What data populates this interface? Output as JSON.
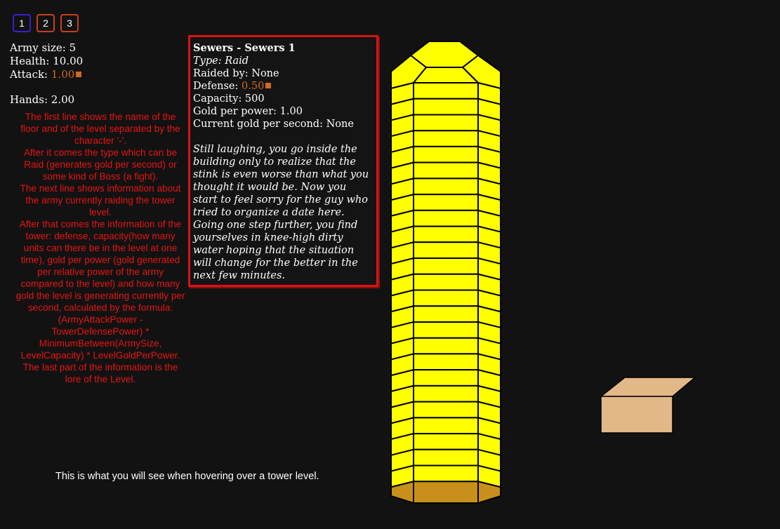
{
  "tabs": [
    {
      "label": "1",
      "color": "#3a1fd0"
    },
    {
      "label": "2",
      "color": "#c8401c"
    },
    {
      "label": "3",
      "color": "#c8401c"
    }
  ],
  "army": {
    "size_label": "Army size: 5",
    "health_label": "Health: 10.00",
    "attack_label": "Attack: ",
    "attack_value": "1.00",
    "hands_label": "Hands: 2.00"
  },
  "help_text": [
    "The first line shows the name of the floor and of the level separated by the character '-'.",
    "After it comes the type which can be Raid (generates gold per second) or some kind of Boss (a fight).",
    "The next line shows information about the army currently raiding the tower level.",
    "After that comes the information of the tower: defense, capacity(how many units can there be in the level at one time), gold per power (gold generated per relative power of the army compared to the level) and how many gold the level is generating currently per second, calculated by the formula: (ArmyAttackPower - TowerDefensePower) * MinimumBetween(ArmySize, LevelCapacity) * LevelGoldPerPower.",
    "The last part of the information is the lore of the Level."
  ],
  "tooltip": {
    "title": "Sewers - Sewers 1",
    "type": "Type: Raid",
    "raided_by": "Raided by: None",
    "defense_label": "Defense: ",
    "defense_value": "0.50",
    "capacity": "Capacity: 500",
    "gold_per_power": "Gold per power: 1.00",
    "current_gold": "Current gold per second: None",
    "lore": [
      "Still laughing, you go inside the building only to realize that the stink is even worse than what you thought it would be. Now you start to feel sorry for the guy who tried to organize a date here.",
      "Going one step further, you find yourselves in knee-high dirty water hoping that the situation will change for the better in the next few minutes."
    ]
  },
  "caption": "This is what you will see when hovering over a tower level.",
  "tower": {
    "level_count": 26,
    "highlighted_level": "bottom",
    "level_color": "#ffff00",
    "base_color": "#c8901a",
    "border_color": "#000000"
  },
  "crate": {
    "front_color": "#e2b888",
    "top_color": "#e2b888"
  }
}
